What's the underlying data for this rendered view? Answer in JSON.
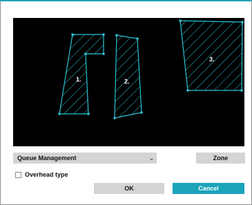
{
  "video": {
    "zones": [
      {
        "label": "1."
      },
      {
        "label": "2."
      },
      {
        "label": "3."
      }
    ],
    "colors": {
      "zone_stroke": "#2bc4d4",
      "background": "#000000"
    }
  },
  "controls": {
    "mode_select_value": "Queue Management",
    "zone_button": "Zone",
    "overhead_label": "Overhead type",
    "overhead_checked": false,
    "ok_button": "OK",
    "cancel_button": "Cancel"
  },
  "colors": {
    "accent": "#1aa3b9",
    "button_gray": "#d4d4d4"
  }
}
